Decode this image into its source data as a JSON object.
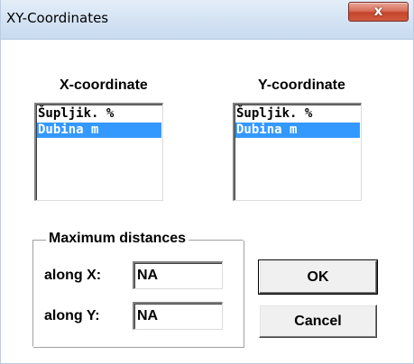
{
  "window": {
    "title": "XY-Coordinates",
    "close_label": "x"
  },
  "x_coordinate": {
    "label": "X-coordinate",
    "items": [
      "Šupljik. %",
      "Dubina m"
    ],
    "selected_index": 1
  },
  "y_coordinate": {
    "label": "Y-coordinate",
    "items": [
      "Šupljik. %",
      "Dubina m"
    ],
    "selected_index": 1
  },
  "max_distances": {
    "legend": "Maximum distances",
    "along_x_label": "along X:",
    "along_x_value": "NA",
    "along_y_label": "along Y:",
    "along_y_value": "NA"
  },
  "buttons": {
    "ok_label": "OK",
    "cancel_label": "Cancel"
  },
  "colors": {
    "selection": "#3399ff",
    "close_button": "#c4452c",
    "titlebar": "#d6e4f4"
  },
  "icons": {
    "close": "close-icon"
  }
}
